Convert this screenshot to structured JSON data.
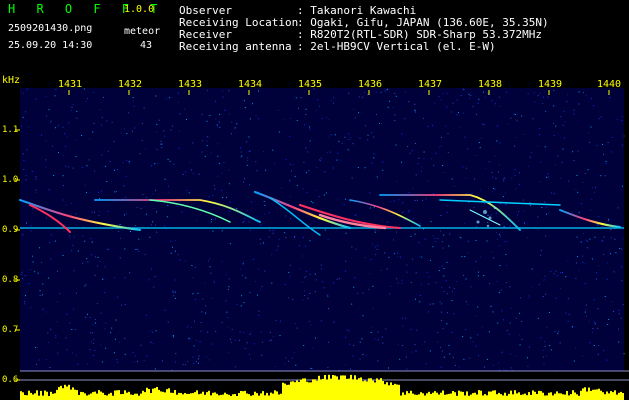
{
  "header": {
    "app_name": "H R O F F T",
    "version": "1.0.0",
    "filename": "2509201430.png",
    "datetime": "25.09.20 14:30",
    "meteor_label": "meteor",
    "meteor_count": "43"
  },
  "info": {
    "rows": [
      {
        "label": "Observer",
        "value": ": Takanori Kawachi"
      },
      {
        "label": "Receiving Location",
        "value": ": Ogaki, Gifu, JAPAN (136.60E, 35.35N)"
      },
      {
        "label": "Receiver",
        "value": ": R820T2(RTL-SDR) SDR-Sharp 53.372MHz"
      },
      {
        "label": "Receiving antenna",
        "value": ": 2el-HB9CV Vertical (el. E-W)"
      }
    ]
  },
  "axes": {
    "y_unit": "kHz",
    "x_ticks": [
      "1431",
      "1432",
      "1433",
      "1434",
      "1435",
      "1436",
      "1437",
      "1438",
      "1439",
      "1440"
    ],
    "y_ticks": [
      "1.1",
      "1.0",
      "0.9",
      "0.8",
      "0.7",
      "0.6"
    ]
  },
  "colors": {
    "title": "#00ff00",
    "labels": "#ffff00",
    "text": "#ffffff",
    "background": "#000000",
    "spectrum_bg": "#00003a",
    "trace_cyan": "#00d0ff",
    "trace_hot": "#ff3060",
    "histogram": "#ffff00"
  }
}
